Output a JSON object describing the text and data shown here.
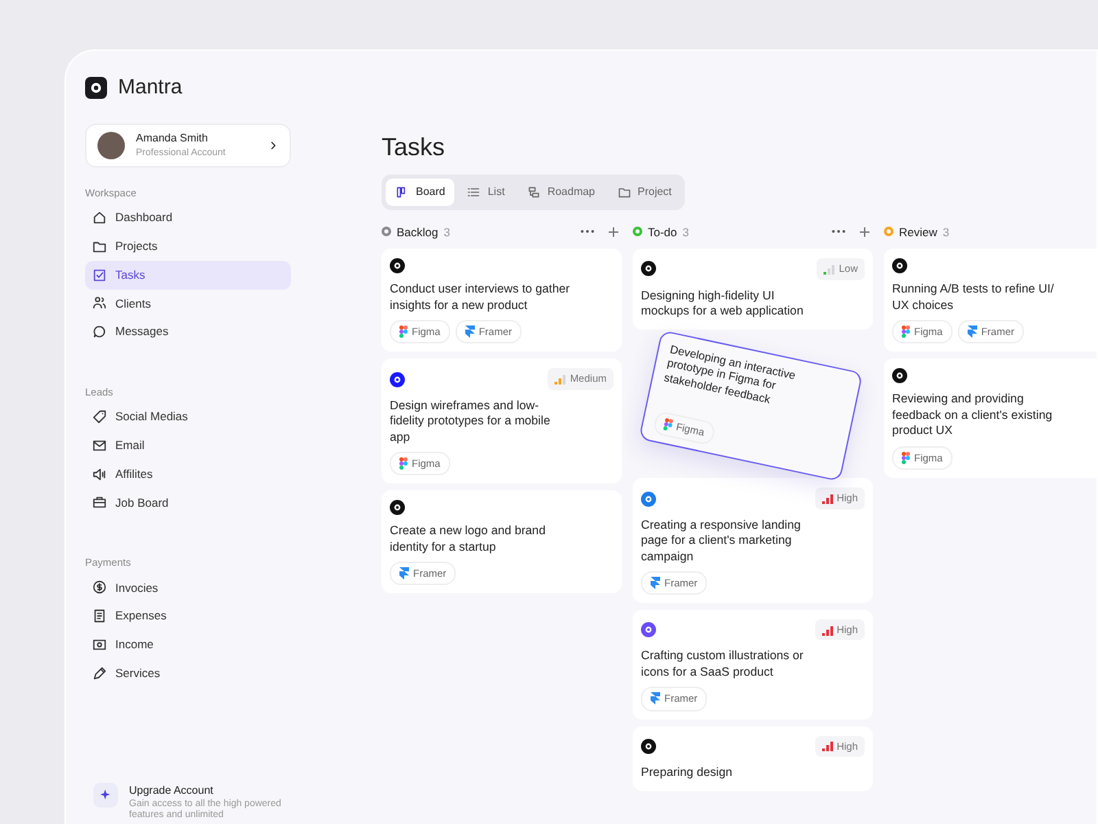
{
  "app": {
    "name": "Mantra"
  },
  "profile": {
    "name": "Amanda Smith",
    "role": "Professional Account"
  },
  "sidebar": {
    "sections": [
      {
        "title": "Workspace",
        "items": [
          {
            "label": "Dashboard",
            "selected": false
          },
          {
            "label": "Projects",
            "selected": false
          },
          {
            "label": "Tasks",
            "selected": true
          },
          {
            "label": "Clients",
            "selected": false
          },
          {
            "label": "Messages",
            "selected": false
          }
        ]
      },
      {
        "title": "Leads",
        "items": [
          {
            "label": "Social Medias",
            "selected": false
          },
          {
            "label": "Email",
            "selected": false
          },
          {
            "label": "Affilites",
            "selected": false
          },
          {
            "label": "Job Board",
            "selected": false
          }
        ]
      },
      {
        "title": "Payments",
        "items": [
          {
            "label": "Invocies",
            "selected": false
          },
          {
            "label": "Expenses",
            "selected": false
          },
          {
            "label": "Income",
            "selected": false
          },
          {
            "label": "Services",
            "selected": false
          }
        ]
      }
    ]
  },
  "upgrade": {
    "title": "Upgrade Account",
    "text": "Gain access to all the high powered features and unlimited"
  },
  "page": {
    "title": "Tasks"
  },
  "tabs": [
    {
      "label": "Board",
      "selected": true
    },
    {
      "label": "List",
      "selected": false
    },
    {
      "label": "Roadmap",
      "selected": false
    },
    {
      "label": "Project",
      "selected": false
    }
  ],
  "columns": [
    {
      "name": "Backlog",
      "count": "3",
      "color": "#8a8a8f",
      "cards": [
        {
          "kind": "task",
          "title": "Conduct user interviews to gather insights for a new product",
          "tags": [
            {
              "kind": "figma",
              "label": "Figma"
            },
            {
              "kind": "framer",
              "label": "Framer"
            }
          ]
        },
        {
          "kind": "task",
          "title": "Design wireframes and low-fidelity prototypes for a mobile app",
          "priority": {
            "kind": "medium",
            "label": "Medium"
          },
          "tags": [
            {
              "kind": "figma",
              "label": "Figma"
            }
          ]
        },
        {
          "kind": "task",
          "title": "Create a new logo and brand identity for a startup",
          "tags": [
            {
              "kind": "framer",
              "label": "Framer"
            }
          ]
        }
      ]
    },
    {
      "name": "To-do",
      "count": "3",
      "color": "#3cc13b",
      "cards": [
        {
          "kind": "task",
          "title": "Designing high-fidelity UI mockups for a web application",
          "priority": {
            "kind": "low",
            "label": "Low"
          }
        },
        {
          "kind": "placeholder"
        },
        {
          "kind": "task",
          "title": "Creating a responsive landing page for a client's marketing campaign",
          "priority": {
            "kind": "high",
            "label": "High"
          },
          "tags": [
            {
              "kind": "framer",
              "label": "Framer"
            }
          ]
        },
        {
          "kind": "task",
          "title": "Crafting custom illustrations or icons for a SaaS product",
          "priority": {
            "kind": "high",
            "label": "High"
          },
          "tags": [
            {
              "kind": "framer",
              "label": "Framer"
            }
          ]
        },
        {
          "kind": "task",
          "title": "Preparing design",
          "priority": {
            "kind": "high",
            "label": "High"
          }
        }
      ]
    },
    {
      "name": "Review",
      "count": "3",
      "color": "#f5a623",
      "cards": [
        {
          "kind": "task",
          "title": "Running A/B tests to refine UI/ UX choices",
          "tags": [
            {
              "kind": "figma",
              "label": "Figma"
            },
            {
              "kind": "framer",
              "label": "Framer"
            }
          ]
        },
        {
          "kind": "task",
          "title": "Reviewing and providing feedback on a client's existing product UX",
          "tags": [
            {
              "kind": "figma",
              "label": "Figma"
            }
          ]
        }
      ]
    }
  ],
  "dragging_card": {
    "title": "Developing an interactive prototype in Figma for stakeholder feedback",
    "tags": [
      {
        "kind": "figma",
        "label": "Figma"
      }
    ]
  }
}
